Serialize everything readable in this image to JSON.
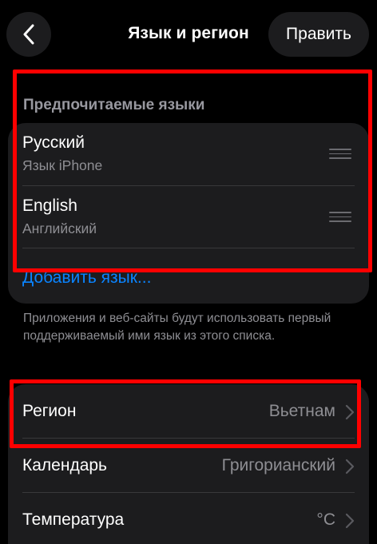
{
  "nav": {
    "title": "Язык и регион",
    "edit_label": "Править"
  },
  "languages": {
    "header": "Предпочитаемые языки",
    "items": [
      {
        "name": "Русский",
        "subtitle": "Язык iPhone"
      },
      {
        "name": "English",
        "subtitle": "Английский"
      }
    ],
    "add_label": "Добавить язык...",
    "footnote": "Приложения и веб-сайты будут использовать первый поддерживаемый ими язык из этого списка."
  },
  "settings": {
    "items": [
      {
        "label": "Регион",
        "value": "Вьетнам"
      },
      {
        "label": "Календарь",
        "value": "Григорианский"
      },
      {
        "label": "Температура",
        "value": "°C"
      }
    ]
  },
  "colors": {
    "background": "#000000",
    "card": "#1c1c1e",
    "accent": "#0a84ff",
    "secondary_text": "#8e8e93",
    "annotation": "#ff0000"
  },
  "icons": {
    "back": "chevron-left-icon",
    "reorder": "reorder-handle-icon",
    "disclosure": "chevron-right-icon"
  }
}
